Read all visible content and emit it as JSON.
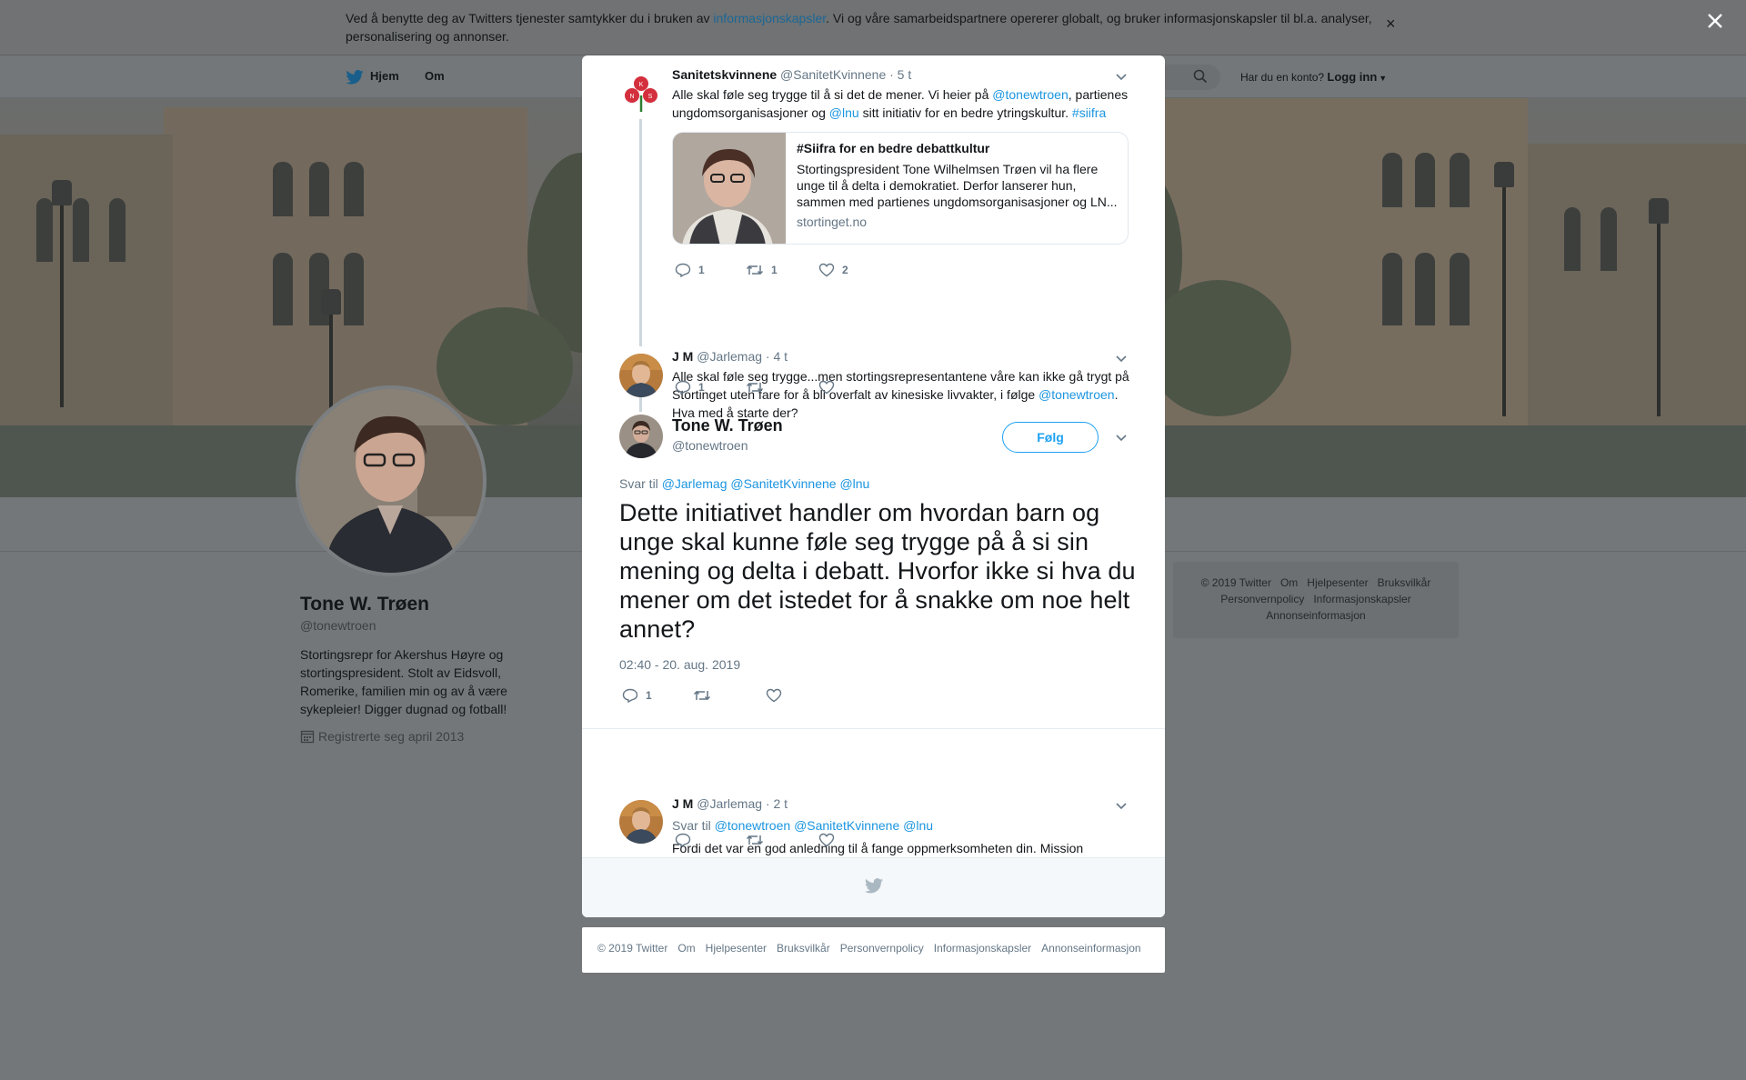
{
  "cookie_banner": {
    "text_before": "Ved å benytte deg av Twitters tjenester samtykker du i bruken av ",
    "link": "informasjonskapsler",
    "text_after": ". Vi og våre samarbeidspartnere opererer globalt, og bruker informasjonskapsler til bl.a. analyser, personalisering og annonser.",
    "close": "×"
  },
  "nav": {
    "home": "Hjem",
    "about": "Om",
    "account_prompt": "Har du en konto?",
    "login": "Logg inn"
  },
  "profile": {
    "name": "Tone W. Trøen",
    "handle": "@tonewtroen",
    "bio": "Stortingsrepr for Akershus Høyre og stortingspresident. Stolt av Eidsvoll, Romerike, familien min og av å være sykepleier! Digger dugnad og fotball!",
    "joined": "Registrerte seg april 2013"
  },
  "side_footer": {
    "links": [
      "© 2019 Twitter",
      "Om",
      "Hjelpesenter",
      "Bruksvilkår",
      "Personvernpolicy",
      "Informasjonskapsler",
      "Annonseinformasjon"
    ]
  },
  "thread": {
    "tweet1": {
      "name": "Sanitetskvinnene",
      "handle": "@SanitetKvinnene",
      "time": "· 5 t",
      "text_1": "Alle skal føle seg trygge til å si det de mener. Vi heier på ",
      "mention_1": "@tonewtroen",
      "text_2": ", partienes ungdomsorganisasjoner og ",
      "mention_2": "@lnu",
      "text_3": " sitt initiativ for en bedre ytringskultur. ",
      "hashtag": "#siifra",
      "card": {
        "title": "#Siifra for en bedre debattkultur",
        "description": "Stortingspresident Tone Wilhelmsen Trøen vil ha flere unge til å delta i demokratiet. Derfor lanserer hun, sammen med partienes ungdomsorganisasjoner og LN...",
        "domain": "stortinget.no"
      },
      "replies": "1",
      "retweets": "1",
      "likes": "2"
    },
    "tweet2": {
      "name": "J M",
      "handle": "@Jarlemag",
      "time": "· 4 t",
      "text_1": "Alle skal føle seg trygge...men stortingsrepresentantene våre kan ikke gå trygt på Stortinget uten fare for å bli overfalt av kinesiske livvakter, i følge ",
      "mention": "@tonewtroen",
      "text_2": ". Hva med å starte der?",
      "replies": "1"
    },
    "main": {
      "name": "Tone W. Trøen",
      "handle": "@tonewtroen",
      "follow": "Følg",
      "reply_to_label": "Svar til ",
      "reply_to": [
        "@Jarlemag",
        "@SanitetKvinnene",
        "@lnu"
      ],
      "text": "Dette initiativet handler om hvordan barn og unge skal kunne føle seg trygge på å si sin mening og delta i debatt. Hvorfor ikke si hva du mener om det istedet for å snakke om noe helt annet?",
      "timestamp": "02:40 - 20. aug. 2019",
      "replies": "1"
    },
    "reply": {
      "name": "J M",
      "handle": "@Jarlemag",
      "time": "· 2 t",
      "reply_to_label": "Svar til ",
      "reply_to": [
        "@tonewtroen",
        "@SanitetKvinnene",
        "@lnu"
      ],
      "text": "Fordi det var en god anledning til å fange oppmerksomheten din. Mission accomplished!"
    }
  },
  "bottom_footer": {
    "links": [
      "© 2019 Twitter",
      "Om",
      "Hjelpesenter",
      "Bruksvilkår",
      "Personvernpolicy",
      "Informasjonskapsler",
      "Annonseinformasjon"
    ]
  },
  "colors": {
    "link": "#1b95e0",
    "follow": "#1da1f2",
    "overlay": "#737779",
    "secondary_text": "#657786"
  },
  "icons": [
    "twitter-bird-icon",
    "search-icon",
    "calendar-icon",
    "reply-icon",
    "retweet-icon",
    "like-icon",
    "chevron-down-icon",
    "close-icon"
  ]
}
